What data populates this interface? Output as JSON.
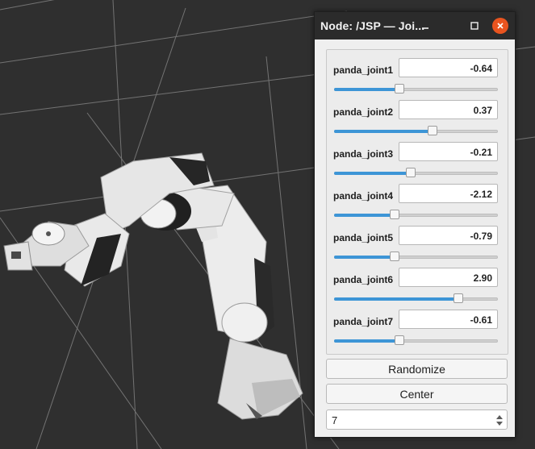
{
  "window": {
    "title": "Node: /JSP — Joi...",
    "minimize_icon": "minimize-icon",
    "maximize_icon": "maximize-icon",
    "close_icon": "close-icon",
    "close_color": "#e9541f"
  },
  "joints": [
    {
      "name": "panda_joint1",
      "value": "-0.64",
      "level": 0.4
    },
    {
      "name": "panda_joint2",
      "value": "0.37",
      "level": 0.6
    },
    {
      "name": "panda_joint3",
      "value": "-0.21",
      "level": 0.47
    },
    {
      "name": "panda_joint4",
      "value": "-2.12",
      "level": 0.37
    },
    {
      "name": "panda_joint5",
      "value": "-0.79",
      "level": 0.37
    },
    {
      "name": "panda_joint6",
      "value": "2.90",
      "level": 0.76
    },
    {
      "name": "panda_joint7",
      "value": "-0.61",
      "level": 0.4
    }
  ],
  "buttons": {
    "randomize": "Randomize",
    "center": "Center"
  },
  "spinbox": {
    "value": "7"
  },
  "colors": {
    "slider_fill": "#3d95d6",
    "titlebar": "#2b2b2b",
    "viewport_bg": "#2f2f2f"
  }
}
